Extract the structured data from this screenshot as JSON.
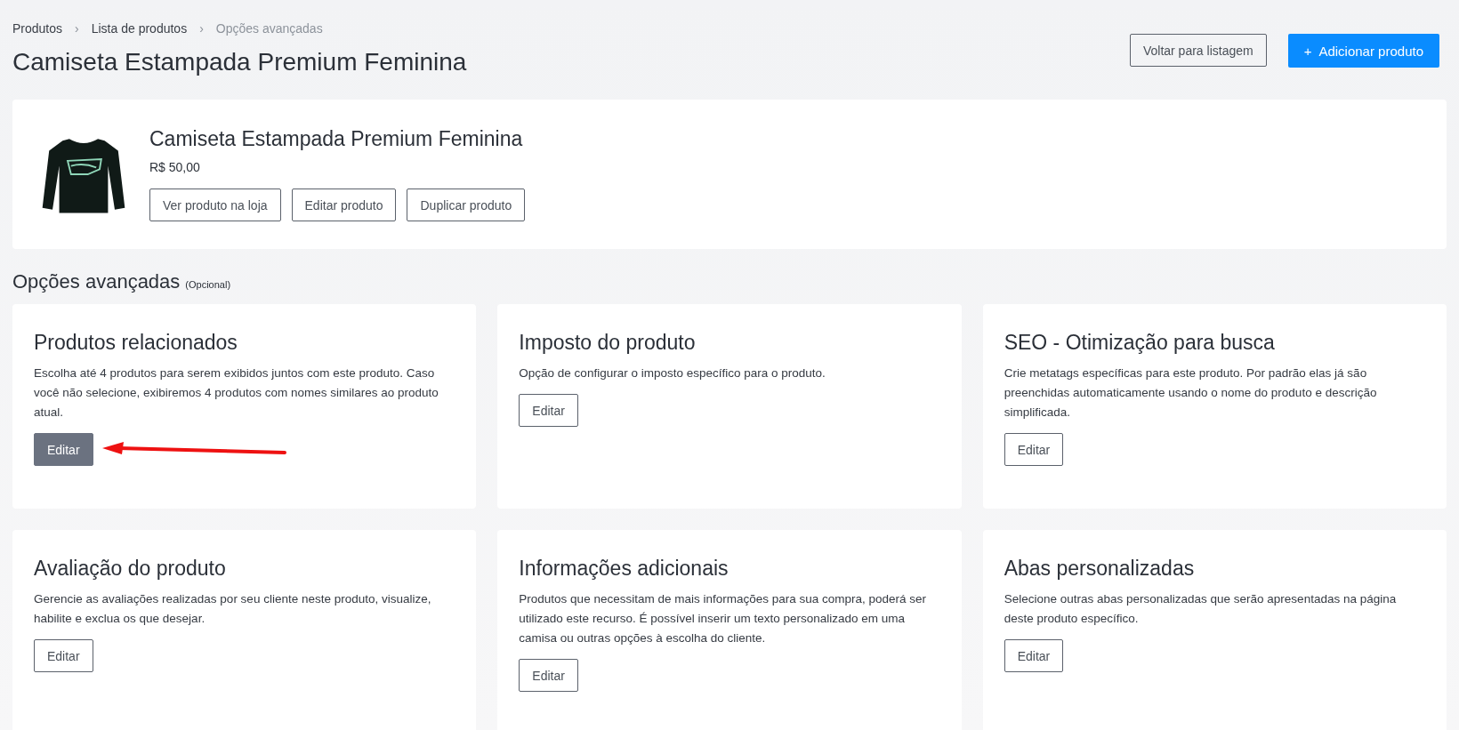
{
  "breadcrumbs": [
    {
      "label": "Produtos",
      "current": false
    },
    {
      "label": "Lista de produtos",
      "current": false
    },
    {
      "label": "Opções avançadas",
      "current": true
    }
  ],
  "breadcrumb_separator": "›",
  "page_title": "Camiseta Estampada Premium Feminina",
  "header_buttons": [
    {
      "label": "Voltar para listagem",
      "kind": "outline"
    },
    {
      "label": "Adicionar produto",
      "kind": "primary",
      "icon": "+"
    }
  ],
  "product": {
    "name": "Camiseta Estampada Premium Feminina",
    "price": "R$ 50,00",
    "actions": [
      "Ver produto na loja",
      "Editar produto",
      "Duplicar produto"
    ]
  },
  "section": {
    "title": "Opções avançadas",
    "note": "(Opcional)"
  },
  "cards": [
    {
      "title": "Produtos relacionados",
      "description": "Escolha até 4 produtos para serem exibidos juntos com este produto. Caso você não selecione, exibiremos 4 produtos com nomes similares ao produto atual.",
      "button": {
        "label": "Editar",
        "highlighted": true
      }
    },
    {
      "title": "Imposto do produto",
      "description": "Opção de configurar o imposto específico para o produto.",
      "button": {
        "label": "Editar",
        "highlighted": false
      }
    },
    {
      "title": "SEO - Otimização para busca",
      "description": "Crie metatags específicas para este produto. Por padrão elas já são preenchidas automaticamente usando o nome do produto e descrição simplificada.",
      "button": {
        "label": "Editar",
        "highlighted": false
      }
    },
    {
      "title": "Avaliação do produto",
      "description": "Gerencie as avaliações realizadas por seu cliente neste produto, visualize, habilite e exclua os que desejar.",
      "button": {
        "label": "Editar",
        "highlighted": false
      }
    },
    {
      "title": "Informações adicionais",
      "description": "Produtos que necessitam de mais informações para sua compra, poderá ser utilizado este recurso. É possível inserir um texto personalizado em uma camisa ou outras opções à escolha do cliente.",
      "button": {
        "label": "Editar",
        "highlighted": false
      }
    },
    {
      "title": "Abas personalizadas",
      "description": "Selecione outras abas personalizadas que serão apresentadas na página deste produto específico.",
      "button": {
        "label": "Editar",
        "highlighted": false
      }
    }
  ]
}
